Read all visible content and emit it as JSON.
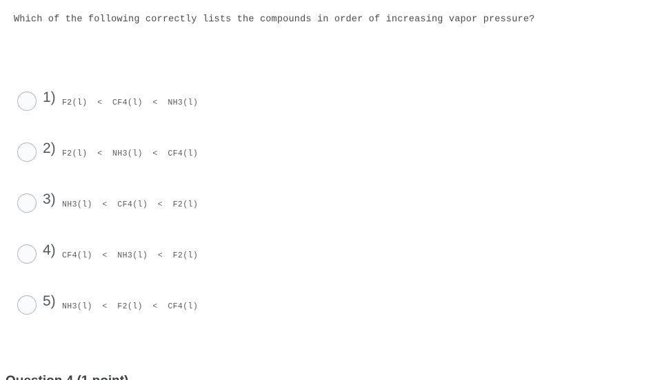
{
  "question": {
    "prompt": "Which of the following correctly lists the compounds in order of increasing vapor pressure?"
  },
  "options": [
    {
      "number": "1)",
      "text": "F2(l)  <  CF4(l)  <  NH3(l)",
      "selected": false
    },
    {
      "number": "2)",
      "text": "F2(l)  <  NH3(l)  <  CF4(l)",
      "selected": false
    },
    {
      "number": "3)",
      "text": "NH3(l)  <  CF4(l)  <  F2(l)",
      "selected": false
    },
    {
      "number": "4)",
      "text": "CF4(l)  <  NH3(l)  <  F2(l)",
      "selected": false
    },
    {
      "number": "5)",
      "text": "NH3(l)  <  F2(l)  <  CF4(l)",
      "selected": false
    }
  ],
  "next_question": {
    "heading": "Question 4 (1 point)"
  },
  "colors": {
    "background": "#ffffff",
    "prompt_text": "#4a4a4a",
    "option_number": "#53565e",
    "option_text": "#5a5a5a",
    "radio_border": "#b2b5bf",
    "radio_fill": "#fafbfd",
    "heading_text": "#3d4148"
  }
}
